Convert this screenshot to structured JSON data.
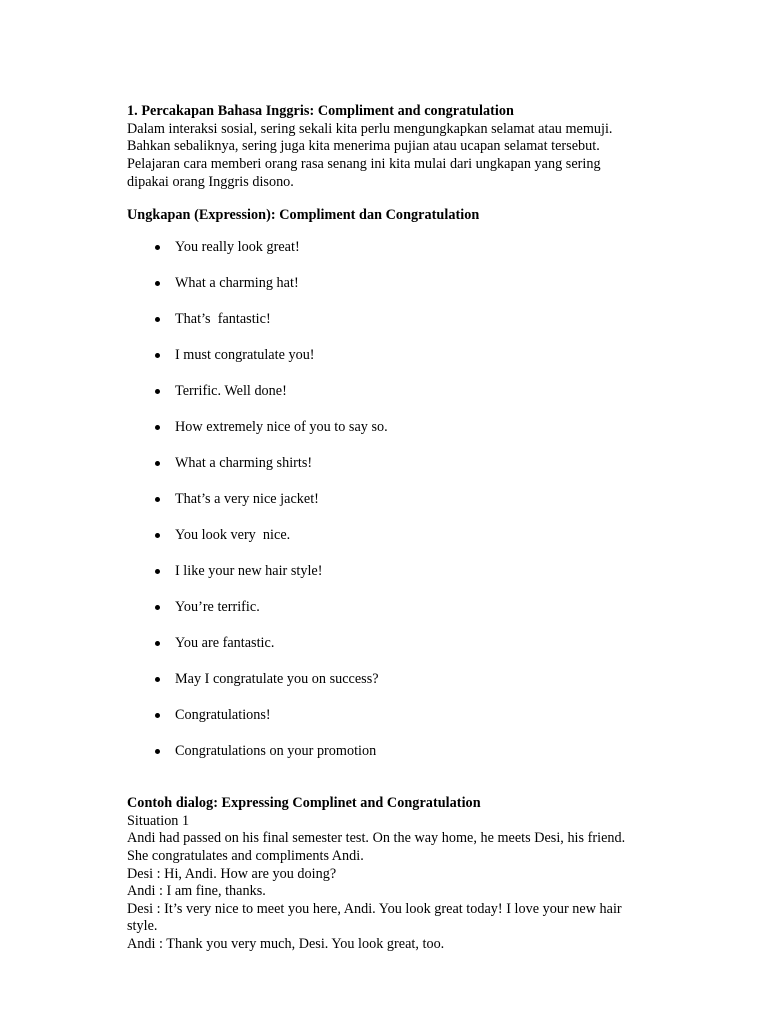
{
  "document": {
    "section1": {
      "heading": "1. Percakapan Bahasa Inggris: Compliment and congratulation",
      "paragraph": "Dalam interaksi sosial, sering sekali kita perlu mengungkapkan selamat atau memuji.\nBahkan sebaliknya, sering juga kita menerima pujian atau ucapan selamat tersebut.\nPelajaran cara memberi orang rasa senang ini kita mulai dari ungkapan yang sering\ndipakai orang Inggris disono."
    },
    "expressions": {
      "heading": "Ungkapan (Expression): Compliment dan Congratulation",
      "items": [
        "You really look great!",
        "What a charming hat!",
        "That’s  fantastic!",
        "I must congratulate you!",
        "Terrific. Well done!",
        "How extremely nice of you to say so.",
        "What a charming shirts!",
        "That’s a very nice jacket!",
        "You look very  nice.",
        "I like your new hair style!",
        "You’re terrific.",
        "You are fantastic.",
        "May I congratulate you on success?",
        "Congratulations!",
        "Congratulations on your promotion"
      ]
    },
    "dialog": {
      "heading": "Contoh dialog: Expressing Complinet and Congratulation",
      "situation_label": "Situation 1",
      "narration": "Andi had passed on his final semester test. On the way home, he meets Desi, his friend.\nShe congratulates and compliments Andi.",
      "lines": [
        "Desi : Hi, Andi. How are you doing?",
        "Andi : I am fine, thanks.",
        "Desi : It’s very nice to meet you here, Andi. You look great today! I love your new hair\nstyle.",
        "Andi : Thank you very much, Desi. You look great, too."
      ]
    }
  }
}
